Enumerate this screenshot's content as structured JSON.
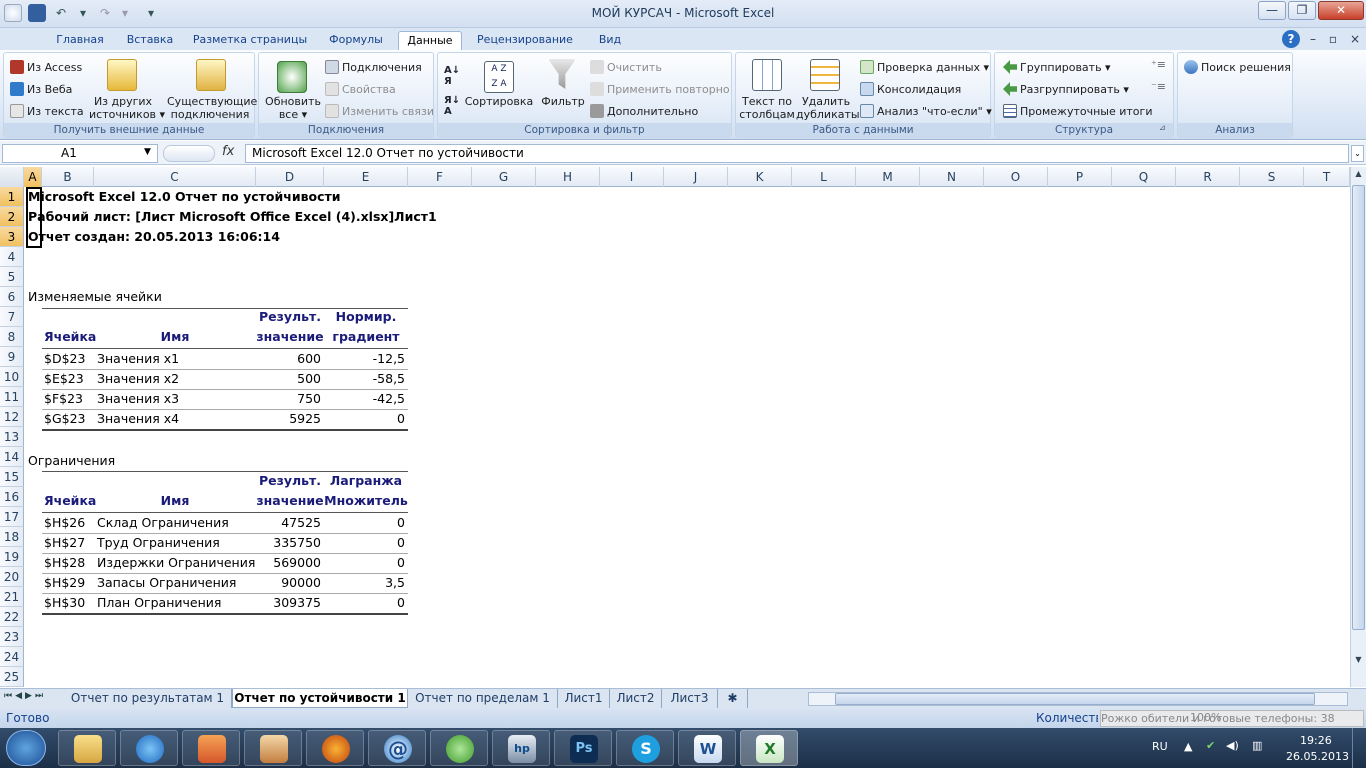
{
  "window": {
    "title": "МОЙ КУРСАЧ - Microsoft Excel"
  },
  "tabs": [
    "Главная",
    "Вставка",
    "Разметка страницы",
    "Формулы",
    "Данные",
    "Рецензирование",
    "Вид"
  ],
  "active_tab": "Данные",
  "ribbon": {
    "get_external": {
      "label": "Получить внешние данные",
      "from_access": "Из Access",
      "from_web": "Из Веба",
      "from_text": "Из текста",
      "other_sources": "Из других",
      "other_sources2": "источников",
      "existing": "Существующие",
      "existing2": "подключения"
    },
    "connections": {
      "label": "Подключения",
      "refresh": "Обновить",
      "refresh2": "все",
      "conn": "Подключения",
      "props": "Свойства",
      "edit_links": "Изменить связи"
    },
    "sort_filter": {
      "label": "Сортировка и фильтр",
      "sort": "Сортировка",
      "filter": "Фильтр",
      "clear": "Очистить",
      "reapply": "Применить повторно",
      "advanced": "Дополнительно"
    },
    "data_tools": {
      "label": "Работа с данными",
      "text_to_cols": "Текст по",
      "text_to_cols2": "столбцам",
      "remove_dup": "Удалить",
      "remove_dup2": "дубликаты",
      "validation": "Проверка данных",
      "consolidate": "Консолидация",
      "whatif": "Анализ \"что-если\""
    },
    "outline": {
      "label": "Структура",
      "group": "Группировать",
      "ungroup": "Разгруппировать",
      "subtotal": "Промежуточные итоги"
    },
    "analysis": {
      "label": "Анализ",
      "solver": "Поиск решения"
    }
  },
  "formula_bar": {
    "name_box": "A1",
    "fx": "fx",
    "content": "Microsoft Excel 12.0 Отчет по устойчивости"
  },
  "columns": [
    "A",
    "B",
    "C",
    "D",
    "E",
    "F",
    "G",
    "H",
    "I",
    "J",
    "K",
    "L",
    "M",
    "N",
    "O",
    "P",
    "Q",
    "R",
    "S",
    "T"
  ],
  "rows": [
    "1",
    "2",
    "3",
    "4",
    "5",
    "6",
    "7",
    "8",
    "9",
    "10",
    "11",
    "12",
    "13",
    "14",
    "15",
    "16",
    "17",
    "18",
    "19",
    "20",
    "21",
    "22",
    "23",
    "24",
    "25"
  ],
  "report": {
    "line1": "Microsoft Excel 12.0 Отчет по устойчивости",
    "line2": "Рабочий лист: [Лист Microsoft Office Excel (4).xlsx]Лист1",
    "line3": "Отчет создан: 20.05.2013 16:06:14",
    "changing_title": "Изменяемые ячейки",
    "changing_hdr": {
      "cell": "Ячейка",
      "name": "Имя",
      "res1": "Результ.",
      "res2": "значение",
      "g1": "Нормир.",
      "g2": "градиент"
    },
    "changing_rows": [
      {
        "cell": "$D$23",
        "name": "Значения x1",
        "value": "600",
        "grad": "-12,5"
      },
      {
        "cell": "$E$23",
        "name": "Значения x2",
        "value": "500",
        "grad": "-58,5"
      },
      {
        "cell": "$F$23",
        "name": "Значения x3",
        "value": "750",
        "grad": "-42,5"
      },
      {
        "cell": "$G$23",
        "name": "Значения x4",
        "value": "5925",
        "grad": "0"
      }
    ],
    "constraints_title": "Ограничения",
    "constraints_hdr": {
      "cell": "Ячейка",
      "name": "Имя",
      "res1": "Результ.",
      "res2": "значение",
      "l1": "Лагранжа",
      "l2": "Множитель"
    },
    "constraints_rows": [
      {
        "cell": "$H$26",
        "name": "Склад Ограничения",
        "value": "47525",
        "mult": "0"
      },
      {
        "cell": "$H$27",
        "name": "Труд Ограничения",
        "value": "335750",
        "mult": "0"
      },
      {
        "cell": "$H$28",
        "name": "Издержки Ограничения",
        "value": "569000",
        "mult": "0"
      },
      {
        "cell": "$H$29",
        "name": "Запасы Ограничения",
        "value": "90000",
        "mult": "3,5"
      },
      {
        "cell": "$H$30",
        "name": "План Ограничения",
        "value": "309375",
        "mult": "0"
      }
    ]
  },
  "sheets": [
    "Отчет по результатам 1",
    "Отчет по устойчивости 1",
    "Отчет по пределам 1",
    "Лист1",
    "Лист2",
    "Лист3"
  ],
  "active_sheet": "Отчет по устойчивости 1",
  "status": {
    "ready": "Готово",
    "count": "Количество: 3",
    "zoom": "100%",
    "overlay": "Рожко   обители и готовые телефоны: 38"
  },
  "taskbar": {
    "lang": "RU",
    "time": "19:26",
    "date": "26.05.2013"
  },
  "colors": {
    "accent": "#1e5fb5",
    "selection": "#f1c15f"
  }
}
